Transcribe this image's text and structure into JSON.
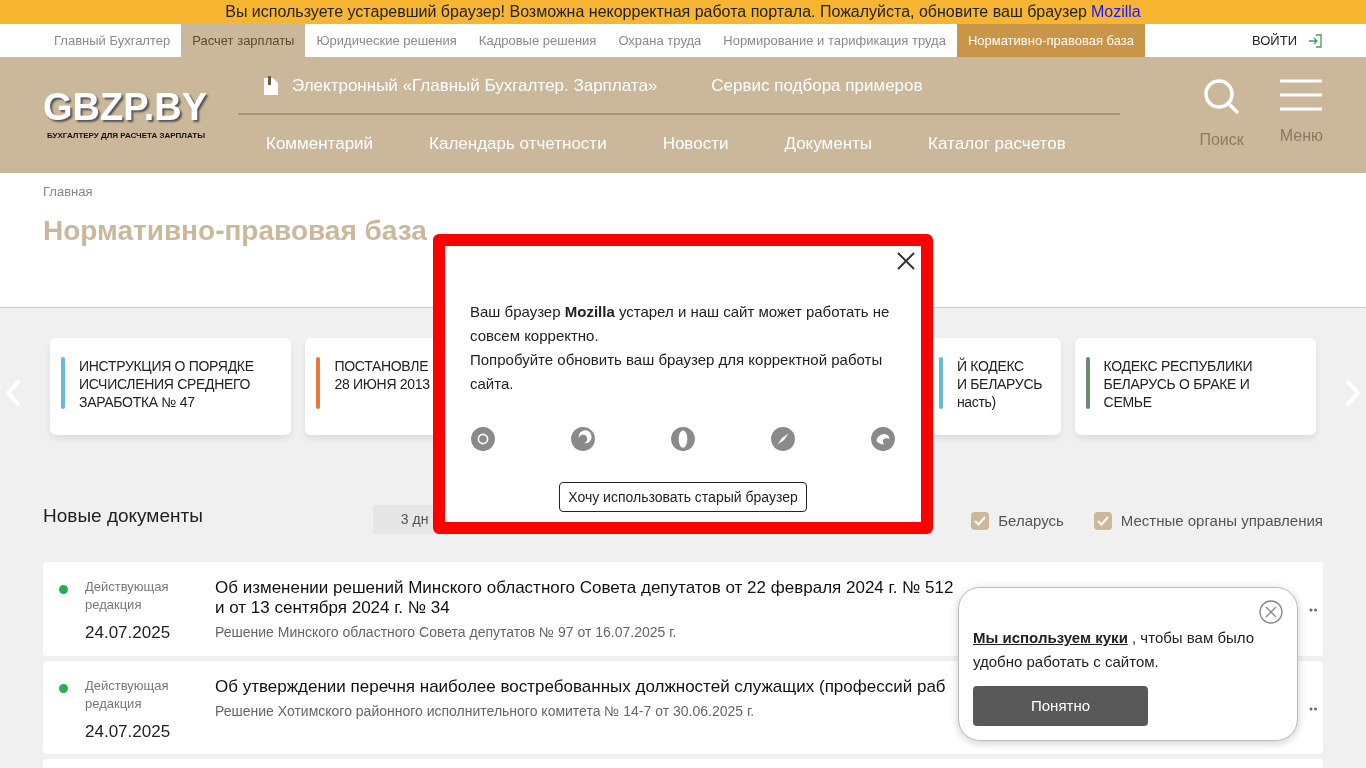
{
  "banner": {
    "text": "Вы используете устаревший браузер! Возможна некорректная работа портала. Пожалуйста, обновите ваш браузер",
    "link": "Mozilla"
  },
  "top_tabs": [
    {
      "label": "Главный Бухгалтер",
      "selected": false,
      "kind": "plain"
    },
    {
      "label": "Расчет зарплаты",
      "selected": true,
      "kind": "plain"
    },
    {
      "label": "Юридические решения",
      "selected": false,
      "kind": "plain"
    },
    {
      "label": "Кадровые решения",
      "selected": false,
      "kind": "plain"
    },
    {
      "label": "Охрана труда",
      "selected": false,
      "kind": "plain"
    },
    {
      "label": "Нормирование и тарификация труда",
      "selected": false,
      "kind": "plain"
    },
    {
      "label": "Нормативно-правовая база",
      "selected": false,
      "kind": "accent"
    }
  ],
  "login": "ВОЙТИ",
  "header": {
    "logo": "GBZP.BY",
    "tagline": "БУХГАЛТЕРУ ДЛЯ РАСЧЕТА ЗАРПЛАТЫ",
    "upper_links": [
      "Электронный «Главный Бухгалтер. Зарплата»",
      "Сервис подбора примеров"
    ],
    "nav": [
      "Комментарий",
      "Календарь отчетности",
      "Новости",
      "Документы",
      "Каталог расчетов"
    ],
    "search": "Поиск",
    "menu": "Меню"
  },
  "breadcrumb": "Главная",
  "page_title": "Нормативно-правовая база",
  "cards": [
    {
      "lines": [
        "ИНСТРУКЦИЯ О ПОРЯДКЕ",
        "ИСЧИСЛЕНИЯ СРЕДНЕГО",
        "ЗАРАБОТКА № 47"
      ],
      "color": "#6ab8dc"
    },
    {
      "lines": [
        "ПОСТАНОВЛЕ",
        "28 ИЮНЯ 2013"
      ],
      "color": "#e8773c"
    },
    {
      "lines": [
        "Й КОДЕКС",
        "И БЕЛАРУСЬ",
        "насть)"
      ],
      "color": "#6ab8dc"
    },
    {
      "lines": [
        "КОДЕКС РЕСПУБЛИКИ",
        "БЕЛАРУСЬ О БРАКЕ И",
        "СЕМЬЕ"
      ],
      "color": "#6b8a72"
    }
  ],
  "section_title": "Новые документы",
  "period": "3 дн",
  "filters": [
    {
      "label": "Беларусь",
      "checked": true
    },
    {
      "label": "Местные органы управления",
      "checked": true
    }
  ],
  "documents": [
    {
      "status": "Действующая редакция",
      "color": "#22b14c",
      "date": "24.07.2025",
      "title": "Об изменении решений Минского областного Совета депутатов от 22 февраля 2024 г. № 512 и от 13 сентября 2024 г. № 34",
      "source": "Решение Минского областного Совета депутатов № 97 от 16.07.2025 г."
    },
    {
      "status": "Действующая редакция",
      "color": "#22b14c",
      "date": "24.07.2025",
      "title": "Об утверждении перечня наиболее востребованных должностей служащих (профессий раб",
      "source": "Решение Хотимского районного исполнительного комитета № 14-7 от 30.06.2025 г."
    }
  ],
  "modal": {
    "text": "Ваш браузер **Mozilla** устарел и наш сайт может работать не совсем корректно.",
    "text2": "Попробуйте обновить ваш браузер для корректной работы сайта.",
    "button": "Хочу использовать старый браузер"
  },
  "cookie": {
    "link": "Мы используем куки",
    "text": ", чтобы вам было удобно работать с сайтом.",
    "button": "Понятно"
  }
}
